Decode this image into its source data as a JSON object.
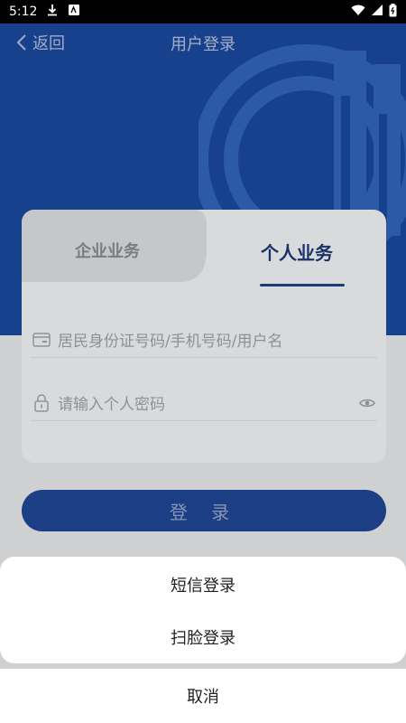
{
  "status_bar": {
    "time": "5:12",
    "icons": [
      "download-icon",
      "news-icon",
      "wifi-icon",
      "signal-icon",
      "battery-icon"
    ]
  },
  "nav": {
    "back_label": "返回",
    "title": "用户登录"
  },
  "tabs": {
    "enterprise": "企业业务",
    "personal": "个人业务"
  },
  "form": {
    "account_placeholder": "居民身份证号码/手机号码/用户名",
    "password_placeholder": "请输入个人密码"
  },
  "login_button": "登 录",
  "sheet": {
    "sms_login": "短信登录",
    "face_login": "扫脸登录",
    "cancel": "取消"
  },
  "colors": {
    "brand_blue": "#17418c",
    "tab_active": "#1b3268"
  }
}
